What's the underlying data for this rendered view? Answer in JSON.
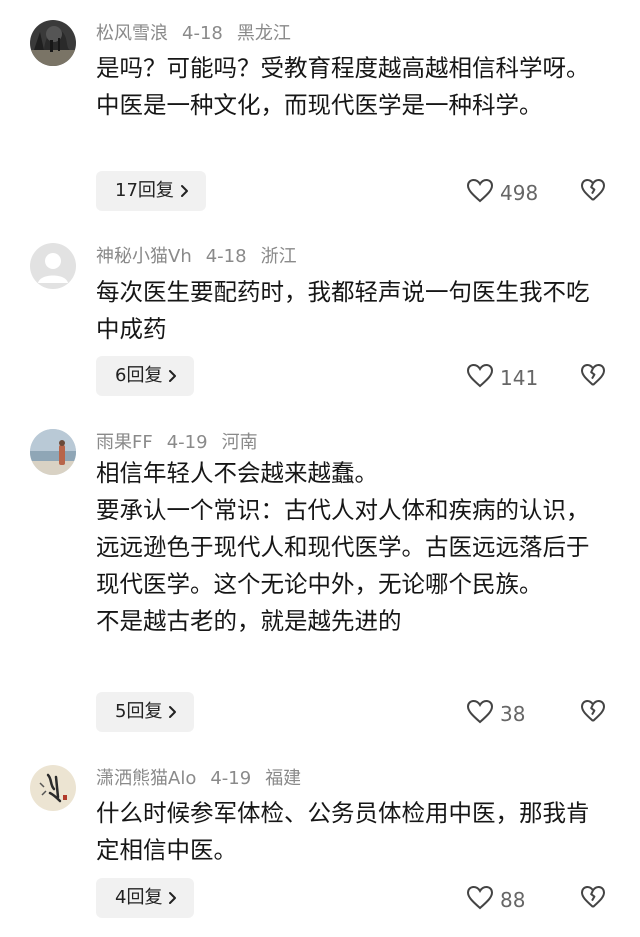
{
  "comments": [
    {
      "username": "松风雪浪",
      "date": "4-18",
      "location": "黑龙江",
      "paragraphs": [
        "是吗？可能吗？受教育程度越高越相信科学呀。中医是一种文化，而现代医学是一种科学。"
      ],
      "reply_label": "17回复",
      "likes": "498"
    },
    {
      "username": "神秘小猫Vh",
      "date": "4-18",
      "location": "浙江",
      "paragraphs": [
        "每次医生要配药时，我都轻声说一句医生我不吃中成药"
      ],
      "reply_label": "6回复",
      "likes": "141"
    },
    {
      "username": "雨果FF",
      "date": "4-19",
      "location": "河南",
      "paragraphs": [
        "相信年轻人不会越来越蠢。",
        "要承认一个常识：古代人对人体和疾病的认识，远远逊色于现代人和现代医学。古医远远落后于现代医学。这个无论中外，无论哪个民族。",
        "不是越古老的，就是越先进的"
      ],
      "reply_label": "5回复",
      "likes": "38"
    },
    {
      "username": "潇洒熊猫Alo",
      "date": "4-19",
      "location": "福建",
      "paragraphs": [
        "什么时候参军体检、公务员体检用中医，那我肯定相信中医。"
      ],
      "reply_label": "4回复",
      "likes": "88"
    }
  ]
}
